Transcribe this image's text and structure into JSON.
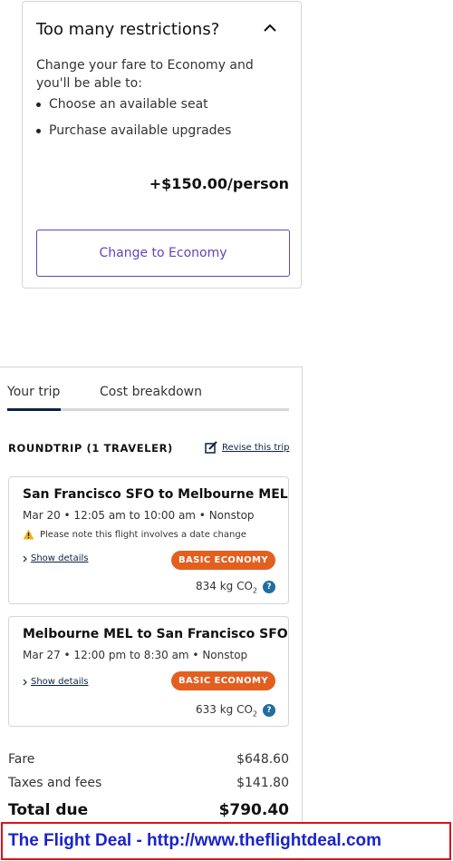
{
  "upsell": {
    "title": "Too many restrictions?",
    "intro": "Change your fare to Economy and you'll be able to:",
    "benefits": [
      "Choose an available seat",
      "Purchase available upgrades"
    ],
    "price": "+$150.00/person",
    "button_label": "Change to Economy"
  },
  "tabs": {
    "your_trip": "Your trip",
    "cost_breakdown": "Cost breakdown",
    "active": "Your trip"
  },
  "trip": {
    "heading": "ROUNDTRIP (1 TRAVELER)",
    "revise_label": "Revise this trip"
  },
  "segments": [
    {
      "route": "San Francisco SFO to Melbourne MEL",
      "times": "Mar 20 • 12:05 am to 10:00 am • Nonstop",
      "warning": "Please note this flight involves a date change",
      "show_details": "Show details",
      "badge": "BASIC ECONOMY",
      "co2_value": "834 kg CO",
      "co2_sub": "2"
    },
    {
      "route": "Melbourne MEL to San Francisco SFO",
      "times": "Mar 27 • 12:00 pm to 8:30 am • Nonstop",
      "show_details": "Show details",
      "badge": "BASIC ECONOMY",
      "co2_value": "633 kg CO",
      "co2_sub": "2"
    }
  ],
  "costs": {
    "fare_label": "Fare",
    "fare_value": "$648.60",
    "taxes_label": "Taxes and fees",
    "taxes_value": "$141.80",
    "total_label": "Total due",
    "total_value": "$790.40"
  },
  "banner": {
    "text": "The Flight Deal - http://www.theflightdeal.com"
  },
  "colors": {
    "accent_purple": "#6244bb",
    "badge_orange": "#e35f1f",
    "navy": "#0c2340",
    "banner_red": "#e0101a",
    "banner_blue": "#1a24c8"
  },
  "icons": [
    "chevron-up-icon",
    "edit-icon",
    "warning-icon",
    "chevron-right-icon",
    "help-icon"
  ]
}
